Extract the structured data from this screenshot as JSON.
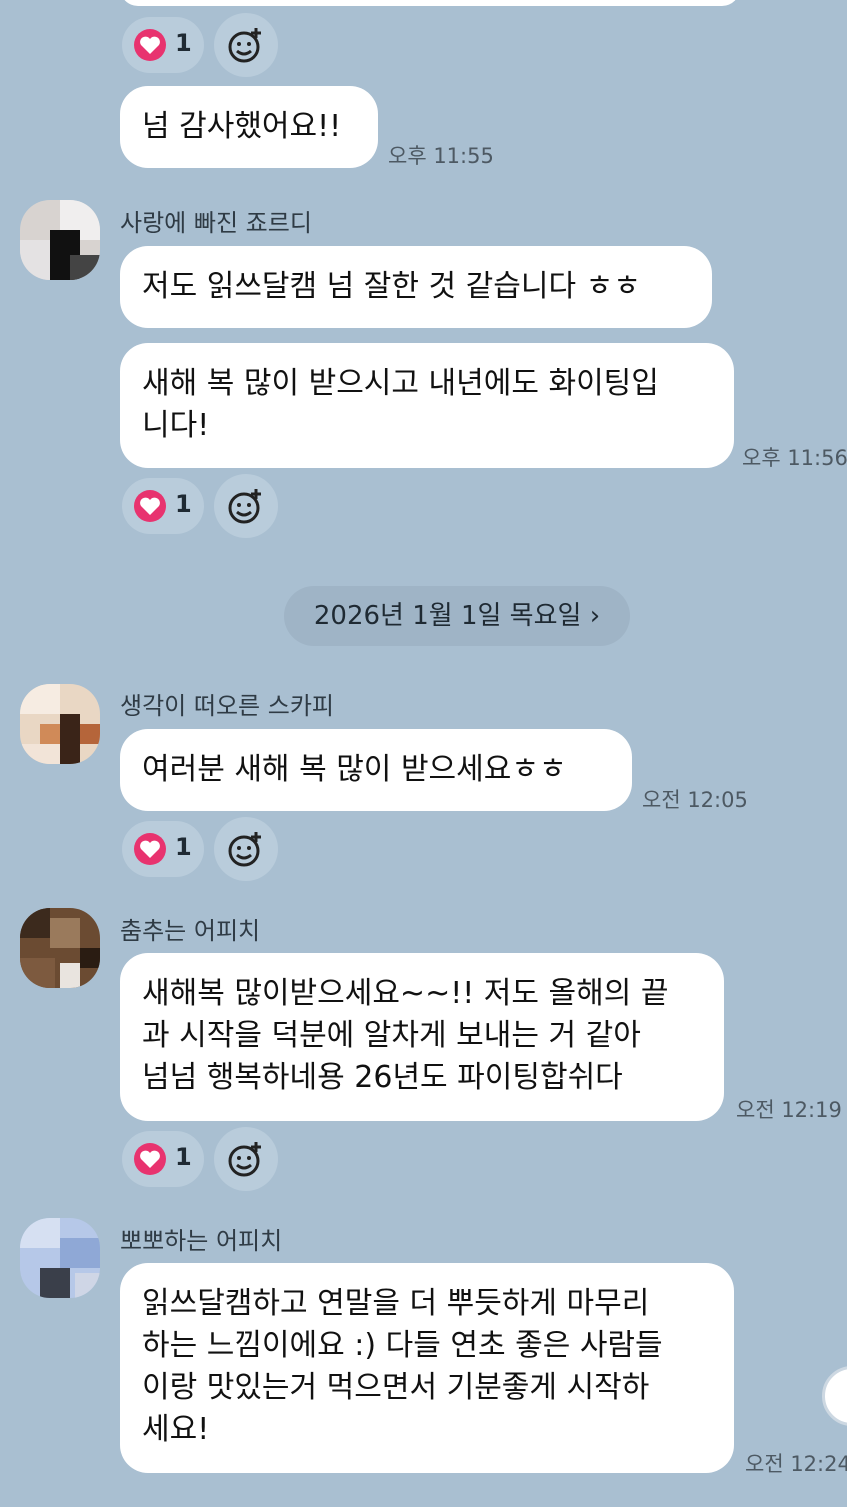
{
  "date_separator": "2026년 1월 1일 목요일 ›",
  "messages": {
    "m0": {
      "text": "넘 감사했어요!!",
      "time": "오후 11:55",
      "likes": "1"
    },
    "m1": {
      "sender": "사랑에 빠진 죠르디",
      "text1": "저도 읽쓰달캠 넘 잘한 것 같습니다 ㅎㅎ",
      "text2": "새해 복 많이 받으시고 내년에도 화이팅입\n니다!",
      "time": "오후 11:56",
      "likes": "1"
    },
    "m2": {
      "sender": "생각이 떠오른 스카피",
      "text": "여러분 새해 복 많이 받으세요ㅎㅎ",
      "time": "오전 12:05",
      "likes": "1"
    },
    "m3": {
      "sender": "춤추는 어피치",
      "text": "새해복 많이받으세요~~!! 저도 올해의 끝\n과 시작을 덕분에 알차게 보내는 거 같아\n넘넘 행복하네용 26년도 파이팅합쉬다",
      "time": "오전 12:19",
      "likes": "1"
    },
    "m4": {
      "sender": "뽀뽀하는 어피치",
      "text": "읽쓰달캠하고 연말을 더 뿌듯하게 마무리\n하는 느낌이에요 :) 다들 연초 좋은 사람들\n이랑 맛있는거 먹으면서 기분좋게 시작하\n세요!",
      "time": "오전 12:24"
    }
  },
  "icons": {
    "like": "heart-icon",
    "react": "add-emoji-icon"
  },
  "colors": {
    "background": "#a9bfd1",
    "heart": "#e8336f",
    "bubble": "#ffffff"
  }
}
